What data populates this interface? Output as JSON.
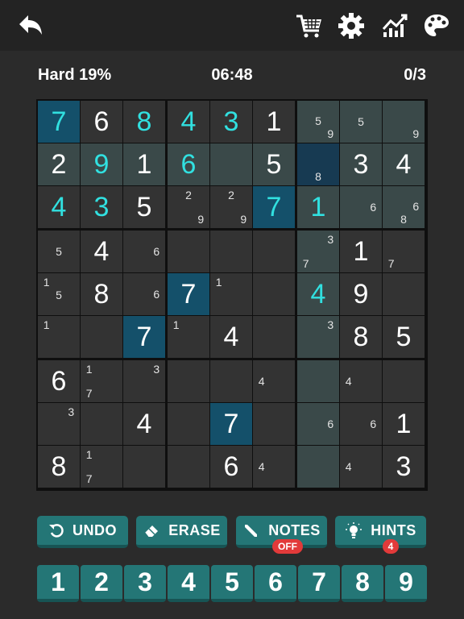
{
  "header": {
    "icons": [
      "back-icon",
      "cart-icon",
      "gear-icon",
      "stats-icon",
      "palette-icon"
    ]
  },
  "status": {
    "difficulty": "Hard 19%",
    "timer": "06:48",
    "mistakes": "0/3"
  },
  "board": {
    "rows": [
      [
        {
          "v": "7",
          "t": "u"
        },
        {
          "v": "6",
          "t": "g"
        },
        {
          "v": "8",
          "t": "u"
        },
        {
          "v": "4",
          "t": "u"
        },
        {
          "v": "3",
          "t": "u"
        },
        {
          "v": "1",
          "t": "g"
        },
        {
          "n": [
            5,
            9
          ]
        },
        {
          "n": [
            5
          ]
        },
        {
          "n": [
            9
          ]
        }
      ],
      [
        {
          "v": "2",
          "t": "g"
        },
        {
          "v": "9",
          "t": "u"
        },
        {
          "v": "1",
          "t": "g"
        },
        {
          "v": "6",
          "t": "u"
        },
        {
          "n": []
        },
        {
          "v": "5",
          "t": "g"
        },
        {
          "n": [
            8
          ]
        },
        {
          "v": "3",
          "t": "g"
        },
        {
          "v": "4",
          "t": "g"
        }
      ],
      [
        {
          "v": "4",
          "t": "u"
        },
        {
          "v": "3",
          "t": "u"
        },
        {
          "v": "5",
          "t": "g"
        },
        {
          "n": [
            2,
            9
          ]
        },
        {
          "n": [
            2,
            9
          ]
        },
        {
          "v": "7",
          "t": "u"
        },
        {
          "v": "1",
          "t": "u"
        },
        {
          "n": [
            6
          ]
        },
        {
          "n": [
            6,
            8
          ]
        }
      ],
      [
        {
          "n": [
            5
          ]
        },
        {
          "v": "4",
          "t": "g"
        },
        {
          "n": [
            6
          ]
        },
        {
          "n": []
        },
        {
          "n": []
        },
        {
          "n": []
        },
        {
          "n": [
            3,
            7
          ]
        },
        {
          "v": "1",
          "t": "g"
        },
        {
          "n": [
            7
          ]
        }
      ],
      [
        {
          "n": [
            1,
            5
          ]
        },
        {
          "v": "8",
          "t": "g"
        },
        {
          "n": [
            6
          ]
        },
        {
          "v": "7",
          "t": "g"
        },
        {
          "n": [
            1
          ]
        },
        {
          "n": []
        },
        {
          "v": "4",
          "t": "u"
        },
        {
          "v": "9",
          "t": "g"
        },
        {
          "n": []
        }
      ],
      [
        {
          "n": [
            1
          ]
        },
        {
          "n": []
        },
        {
          "v": "7",
          "t": "g"
        },
        {
          "n": [
            1
          ]
        },
        {
          "v": "4",
          "t": "g"
        },
        {
          "n": []
        },
        {
          "n": [
            3
          ]
        },
        {
          "v": "8",
          "t": "g"
        },
        {
          "v": "5",
          "t": "g"
        }
      ],
      [
        {
          "v": "6",
          "t": "g"
        },
        {
          "n": [
            1,
            7
          ]
        },
        {
          "n": [
            3
          ]
        },
        {
          "n": []
        },
        {
          "n": []
        },
        {
          "n": [
            4
          ]
        },
        {
          "n": []
        },
        {
          "n": [
            4
          ]
        },
        {
          "n": []
        }
      ],
      [
        {
          "n": [
            3
          ]
        },
        {
          "n": []
        },
        {
          "v": "4",
          "t": "g"
        },
        {
          "n": []
        },
        {
          "v": "7",
          "t": "g"
        },
        {
          "n": []
        },
        {
          "n": [
            6
          ]
        },
        {
          "n": [
            6
          ]
        },
        {
          "v": "1",
          "t": "g"
        }
      ],
      [
        {
          "v": "8",
          "t": "g"
        },
        {
          "n": [
            1,
            7
          ]
        },
        {
          "n": []
        },
        {
          "n": []
        },
        {
          "v": "6",
          "t": "g"
        },
        {
          "n": [
            4
          ]
        },
        {
          "n": []
        },
        {
          "n": [
            4
          ]
        },
        {
          "v": "3",
          "t": "g"
        }
      ]
    ],
    "selected": {
      "row": 1,
      "col": 6
    },
    "same_value_cells": [
      [
        0,
        0
      ],
      [
        2,
        5
      ],
      [
        4,
        3
      ],
      [
        5,
        2
      ],
      [
        7,
        4
      ]
    ]
  },
  "actions": {
    "undo": "UNDO",
    "erase": "ERASE",
    "notes": "NOTES",
    "notes_badge": "OFF",
    "hints": "HINTS",
    "hints_badge": "4"
  },
  "numpad": [
    "1",
    "2",
    "3",
    "4",
    "5",
    "6",
    "7",
    "8",
    "9"
  ],
  "colors": {
    "accent": "#247676",
    "user_digit": "#31e0e0",
    "selected": "#14506a",
    "badge": "#e23a3a"
  }
}
